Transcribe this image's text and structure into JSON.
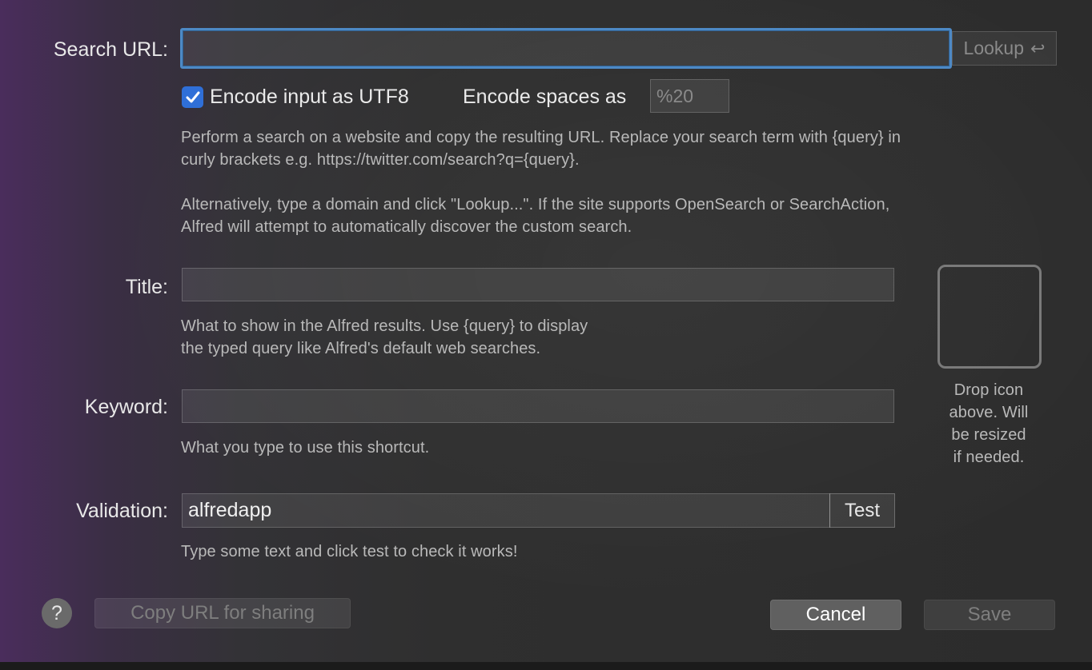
{
  "search": {
    "label": "Search URL:",
    "value": "",
    "lookup_label": "Lookup",
    "lookup_icon": "return-icon"
  },
  "encode": {
    "utf8_label": "Encode input as UTF8",
    "utf8_checked": true,
    "spaces_label": "Encode spaces as",
    "spaces_value": "%20"
  },
  "description": {
    "para1_line1": "Perform a search on a website and copy the resulting URL. Replace your search term with {query} in",
    "para1_line2": "curly brackets e.g. https://twitter.com/search?q={query}.",
    "para2_line1": "Alternatively, type a domain and click \"Lookup...\". If the site supports OpenSearch or SearchAction,",
    "para2_line2": "Alfred will attempt to automatically discover the custom search."
  },
  "title": {
    "label": "Title:",
    "value": "",
    "help_line1": "What to show in the Alfred results. Use {query} to display",
    "help_line2": "the typed query like Alfred's default web searches."
  },
  "keyword": {
    "label": "Keyword:",
    "value": "",
    "help": "What you type to use this shortcut."
  },
  "validation": {
    "label": "Validation:",
    "value": "alfredapp",
    "test_label": "Test",
    "help": "Type some text and click test to check it works!"
  },
  "icon_well": {
    "line1": "Drop icon",
    "line2": "above. Will",
    "line3": "be resized",
    "line4": "if needed."
  },
  "footer": {
    "help_symbol": "?",
    "copy_url_label": "Copy URL for sharing",
    "cancel_label": "Cancel",
    "save_label": "Save"
  },
  "colors": {
    "accent": "#2f6fd8",
    "focus_ring": "#4d89c5"
  }
}
